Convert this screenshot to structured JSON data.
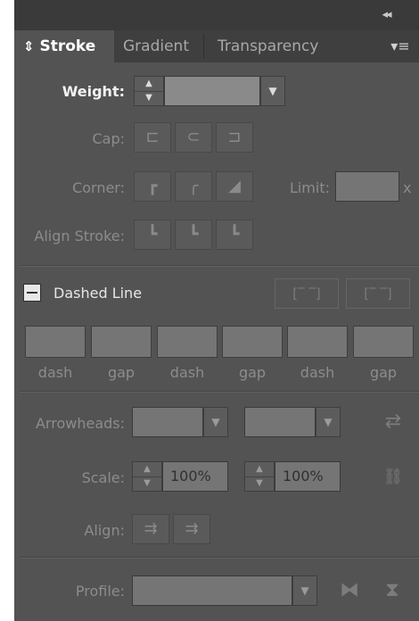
{
  "header": {
    "collapse_icon": "double-chevron-left-icon",
    "collapse_glyph": "◂◂"
  },
  "tabs": [
    {
      "label": "Stroke",
      "active": true,
      "icon": "updown-arrows-icon",
      "icon_glyph": "⇕"
    },
    {
      "label": "Gradient",
      "active": false
    },
    {
      "label": "Transparency",
      "active": false
    }
  ],
  "panel_menu": {
    "icon": "panel-menu-icon",
    "glyph": "▾≡"
  },
  "weight": {
    "label": "Weight:",
    "value": "",
    "stepper_up": "▲",
    "stepper_down": "▼",
    "dropdown": "▼"
  },
  "cap": {
    "label": "Cap:",
    "buttons": [
      {
        "name": "butt-cap-icon",
        "glyph": "⊏"
      },
      {
        "name": "round-cap-icon",
        "glyph": "⊂"
      },
      {
        "name": "projecting-cap-icon",
        "glyph": "⊐"
      }
    ]
  },
  "corner": {
    "label": "Corner:",
    "buttons": [
      {
        "name": "miter-join-icon",
        "glyph": "┏"
      },
      {
        "name": "round-join-icon",
        "glyph": "╭"
      },
      {
        "name": "bevel-join-icon",
        "glyph": "◢"
      }
    ],
    "limit_label": "Limit:",
    "limit_value": "",
    "limit_unit": "x"
  },
  "align_stroke": {
    "label": "Align Stroke:",
    "buttons": [
      {
        "name": "align-center-icon",
        "glyph": "┗"
      },
      {
        "name": "align-inside-icon",
        "glyph": "┗"
      },
      {
        "name": "align-outside-icon",
        "glyph": "┗"
      }
    ]
  },
  "dashed_line": {
    "label": "Dashed Line",
    "checked": false,
    "options": [
      {
        "name": "preserve-dash-lengths-icon",
        "glyph": "[‾ ‾]"
      },
      {
        "name": "align-dashes-to-corners-icon",
        "glyph": "[‾ ‾]"
      }
    ],
    "fields": [
      {
        "label": "dash",
        "value": ""
      },
      {
        "label": "gap",
        "value": ""
      },
      {
        "label": "dash",
        "value": ""
      },
      {
        "label": "gap",
        "value": ""
      },
      {
        "label": "dash",
        "value": ""
      },
      {
        "label": "gap",
        "value": ""
      }
    ]
  },
  "arrowheads": {
    "label": "Arrowheads:",
    "start": "",
    "end": "",
    "dropdown": "▼",
    "swap_icon": "swap-arrows-icon",
    "swap_glyph": "⇄"
  },
  "scale": {
    "label": "Scale:",
    "start": "100%",
    "end": "100%",
    "link_icon": "link-scale-icon",
    "link_glyph": "⛓"
  },
  "align": {
    "label": "Align:",
    "buttons": [
      {
        "name": "arrow-tip-beyond-end-icon",
        "glyph": "⇉"
      },
      {
        "name": "arrow-tip-at-end-icon",
        "glyph": "⇉"
      }
    ]
  },
  "profile": {
    "label": "Profile:",
    "value": "",
    "dropdown": "▼",
    "flip_horizontal": {
      "name": "flip-horizontal-icon",
      "glyph": "⧓"
    },
    "flip_vertical": {
      "name": "flip-vertical-icon",
      "glyph": "⧗"
    }
  }
}
